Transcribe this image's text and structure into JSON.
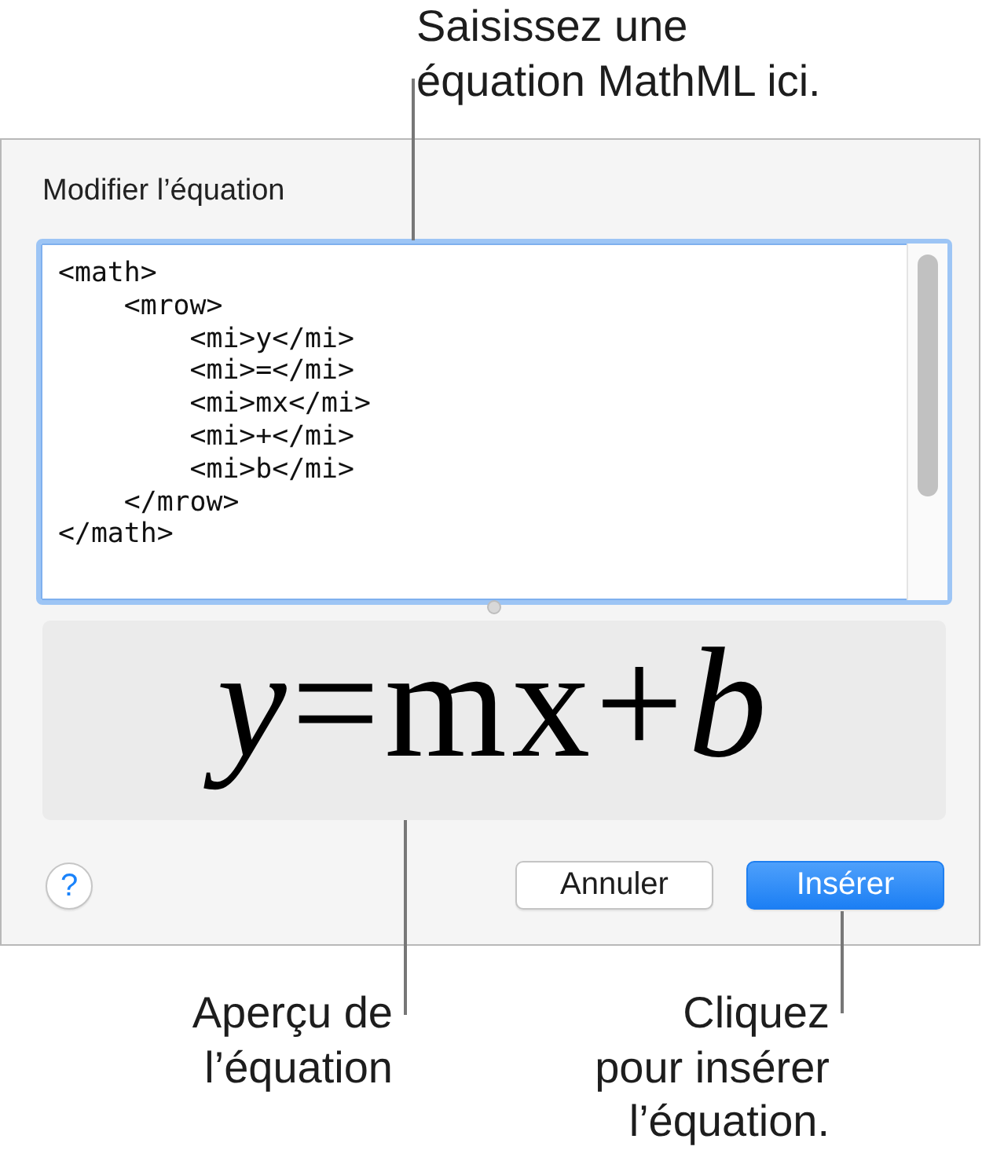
{
  "top_callout": {
    "text": "Saisissez une\néquation MathML ici."
  },
  "dialog": {
    "title": "Modifier l’équation",
    "editor": {
      "focused": true,
      "value": "<math>\n    <mrow>\n        <mi>y</mi>\n        <mi>=</mi>\n        <mi>mx</mi>\n        <mi>+</mi>\n        <mi>b</mi>\n    </mrow>\n</math>"
    },
    "preview": {
      "equation": "*y*=mx+*b*"
    },
    "help_button": {
      "label": "?"
    },
    "buttons": [
      {
        "label": "Annuler",
        "kind": "cancel"
      },
      {
        "label": "Insérer",
        "kind": "confirm"
      }
    ]
  },
  "bottom_callouts": [
    {
      "text": "Aperçu de\nl’équation"
    },
    {
      "text": "Cliquez\npour insérer\nl’équation."
    }
  ]
}
